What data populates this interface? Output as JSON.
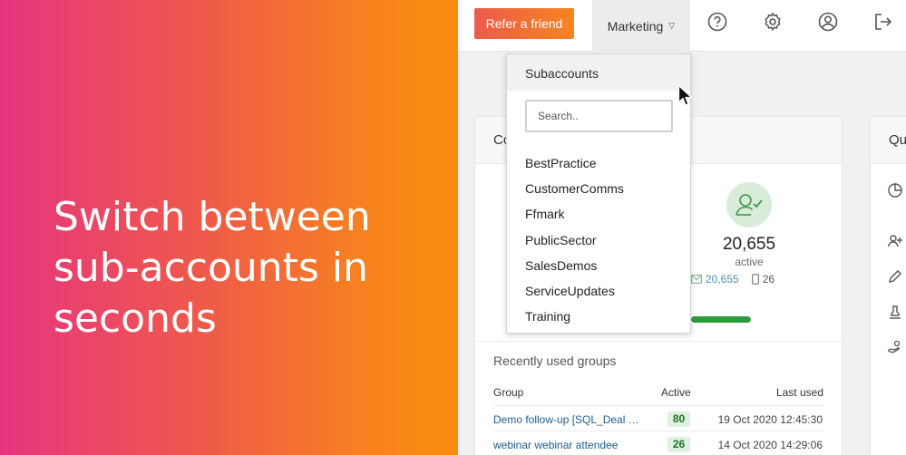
{
  "promo": {
    "lines": [
      "Switch between",
      "sub-accounts in",
      "seconds"
    ]
  },
  "topbar": {
    "refer_label": "Refer a friend",
    "account_label": "Marketing",
    "icons": [
      "help-icon",
      "gear-icon",
      "user-icon",
      "logout-icon"
    ]
  },
  "dropdown": {
    "title": "Subaccounts",
    "search_placeholder": "Search..",
    "search_value": "",
    "items": [
      "BestPractice",
      "CustomerComms",
      "Ffmark",
      "PublicSector",
      "SalesDemos",
      "ServiceUpdates",
      "Training"
    ]
  },
  "contacts_card": {
    "title_visible": "Co",
    "active_count": "20,655",
    "active_label": "active",
    "email_count": "20,655",
    "mobile_count": "26",
    "active_fraction": 1.0
  },
  "recent_groups": {
    "title": "Recently used groups",
    "headers": {
      "group": "Group",
      "active": "Active",
      "last_used": "Last used"
    },
    "rows": [
      {
        "group": "Demo follow-up [SQL_Deal Profile]",
        "active": "80",
        "last_used": "19 Oct 2020 12:45:30"
      },
      {
        "group": "webinar webinar attendee",
        "active": "26",
        "last_used": "14 Oct 2020 14:29:06"
      }
    ]
  },
  "quick_card": {
    "title_visible": "Qu",
    "icons": [
      "pie-chart-icon",
      "add-user-icon",
      "pencil-icon",
      "stamp-icon",
      "hand-icon"
    ]
  },
  "colors": {
    "promo_start": "#e6357f",
    "promo_end": "#fa8c0d",
    "badge_green": "#dff1df",
    "progress_green": "#2d9a3b",
    "link_blue": "#1f5d8f"
  }
}
